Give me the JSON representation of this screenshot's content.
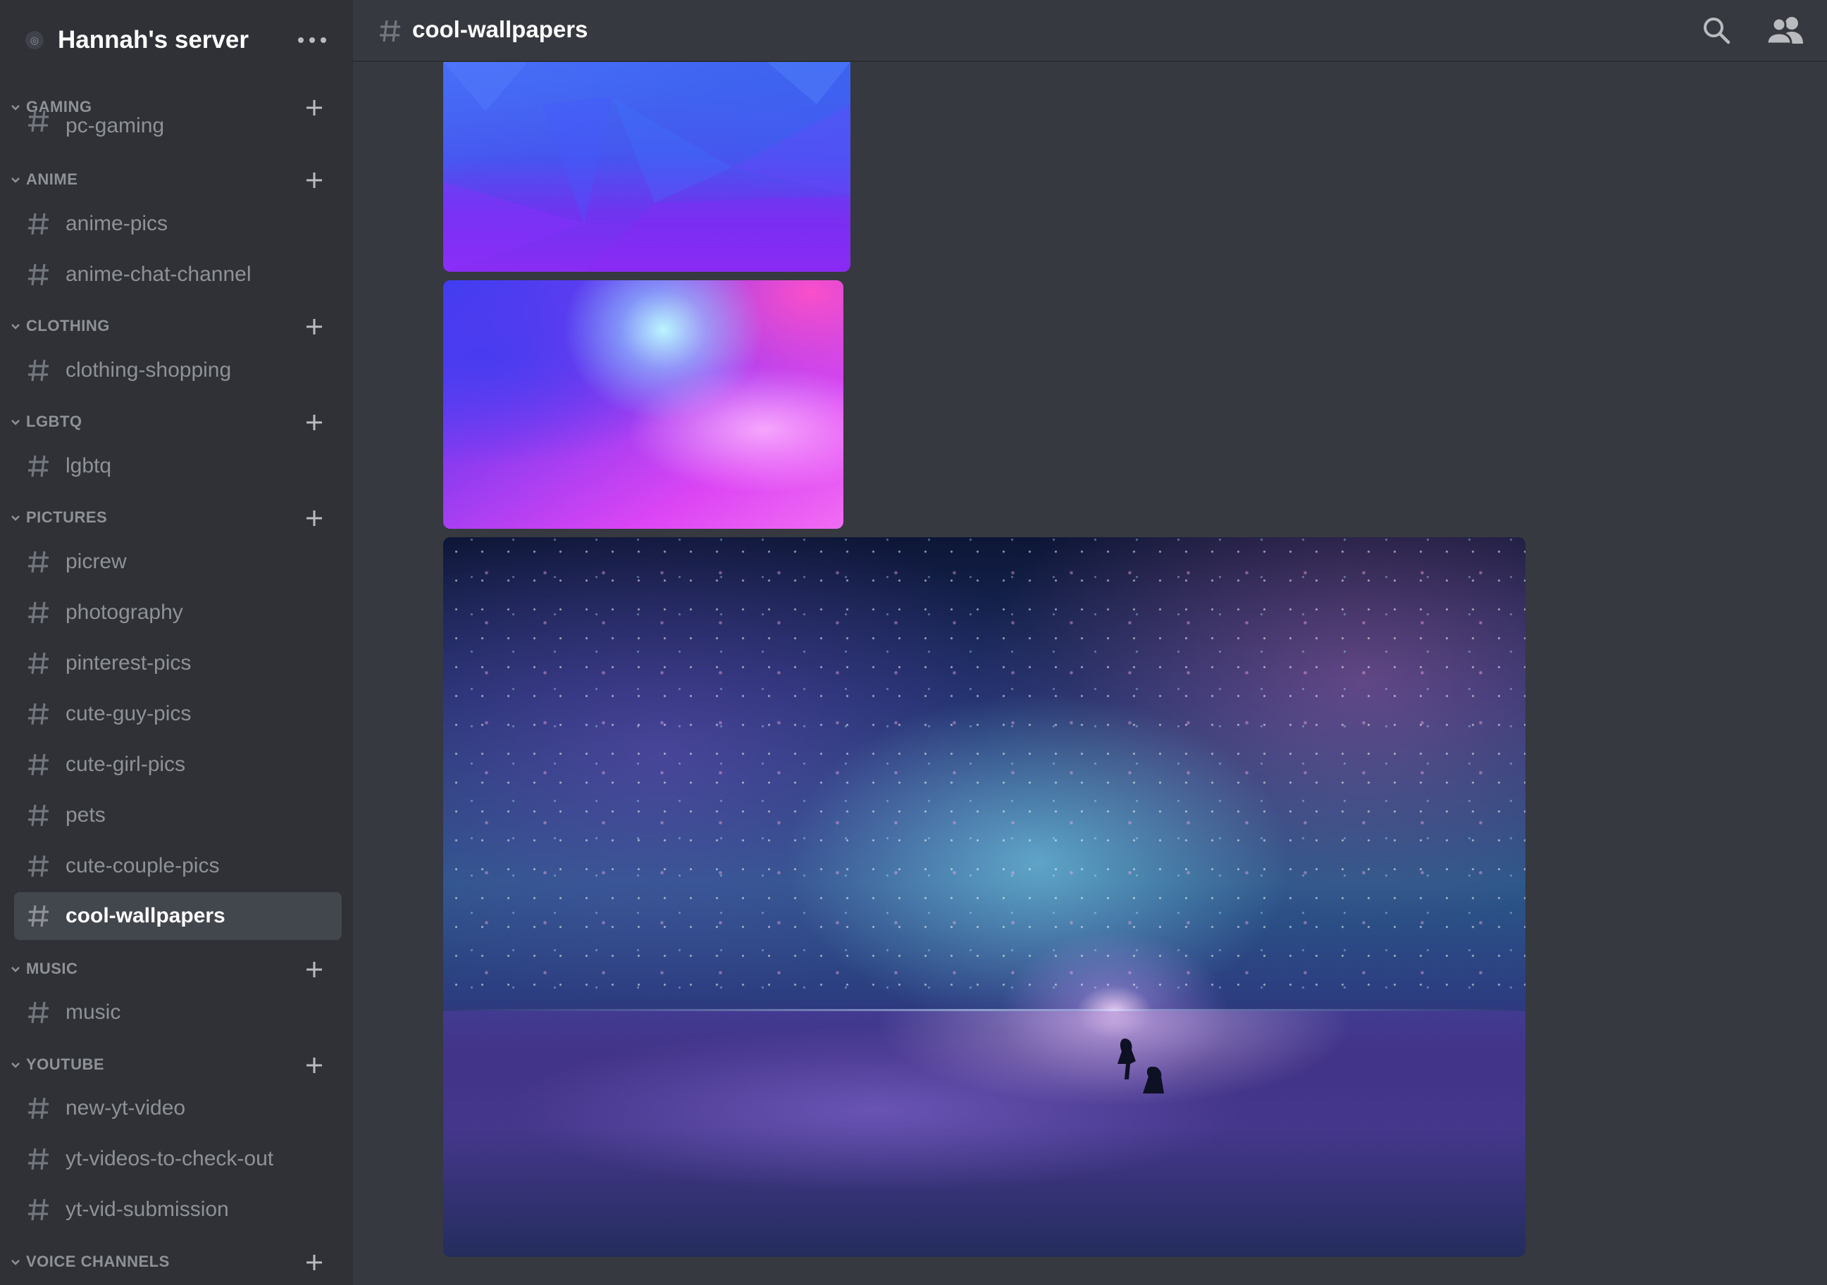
{
  "server": {
    "name": "Hannah's server"
  },
  "categories": [
    {
      "label": "GAMING"
    },
    {
      "label": "ANIME"
    },
    {
      "label": "CLOTHING"
    },
    {
      "label": "LGBTQ"
    },
    {
      "label": "PICTURES"
    },
    {
      "label": "MUSIC"
    },
    {
      "label": "YOUTUBE"
    },
    {
      "label": "VOICE CHANNELS"
    }
  ],
  "channels": [
    {
      "label": "pc-gaming"
    },
    {
      "label": "anime-pics"
    },
    {
      "label": "anime-chat-channel"
    },
    {
      "label": "clothing-shopping"
    },
    {
      "label": "lgbtq"
    },
    {
      "label": "picrew"
    },
    {
      "label": "photography"
    },
    {
      "label": "pinterest-pics"
    },
    {
      "label": "cute-guy-pics"
    },
    {
      "label": "cute-girl-pics"
    },
    {
      "label": "pets"
    },
    {
      "label": "cute-couple-pics"
    },
    {
      "label": "cool-wallpapers",
      "active": true
    },
    {
      "label": "music"
    },
    {
      "label": "new-yt-video"
    },
    {
      "label": "yt-videos-to-check-out"
    },
    {
      "label": "yt-vid-submission"
    }
  ],
  "topbar": {
    "channel_name": "cool-wallpapers"
  },
  "icons": {
    "server": "server-icon",
    "menu": "more-options-icon",
    "chevron": "chevron-down-icon",
    "add": "plus-icon",
    "channel": "hash-icon",
    "search": "search-icon",
    "members": "members-icon"
  },
  "colors": {
    "sidebar_bg": "#2f3136",
    "main_bg": "#36393f",
    "active_channel_bg": "#42464d",
    "muted_text": "#8e9297",
    "white": "#ffffff"
  }
}
